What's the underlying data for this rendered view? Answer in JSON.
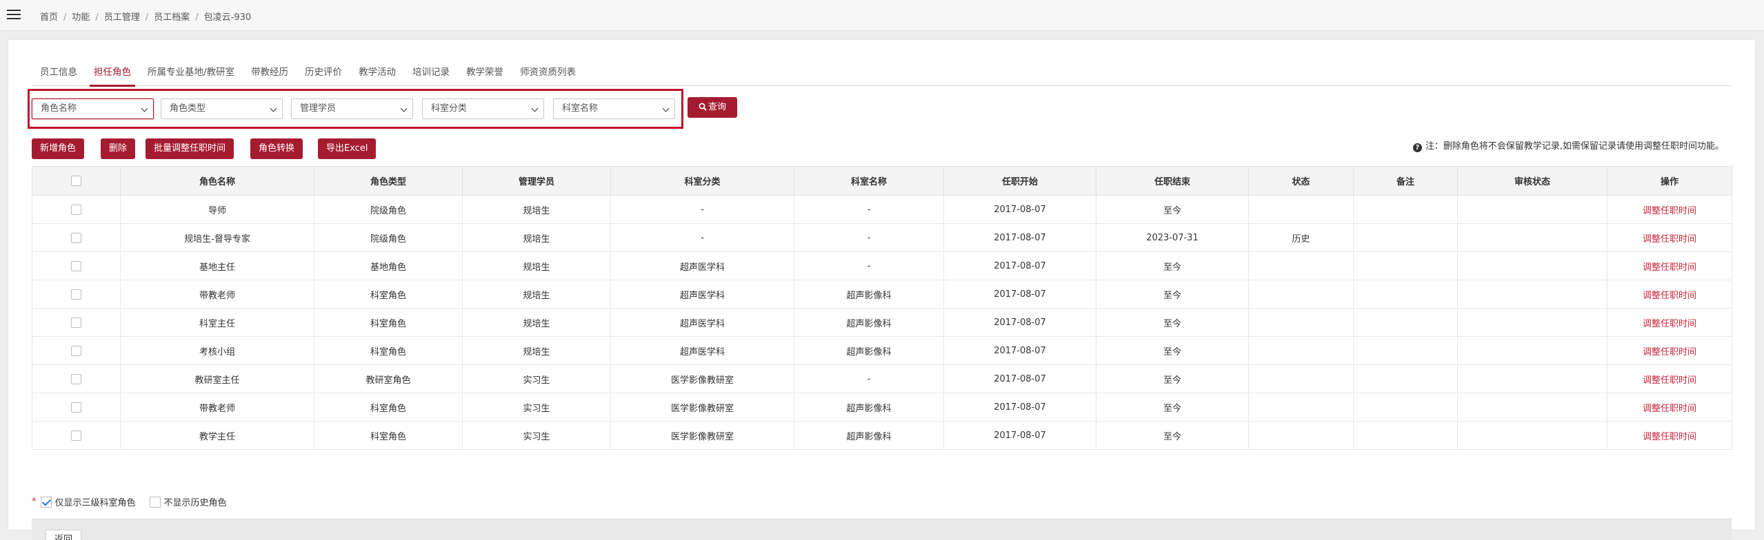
{
  "breadcrumb": [
    "首页",
    "功能",
    "员工管理",
    "员工档案",
    "包凌云-930"
  ],
  "tabs": [
    "员工信息",
    "担任角色",
    "所属专业基地/教研室",
    "带教经历",
    "历史评价",
    "教学活动",
    "培训记录",
    "教学荣誉",
    "师资资质列表"
  ],
  "active_tab": "担任角色",
  "filters": {
    "role_name": "角色名称",
    "role_type": "角色类型",
    "managed_students": "管理学员",
    "dept_category": "科室分类",
    "dept_name": "科室名称",
    "query_label": "查询"
  },
  "toolbar": {
    "add_role": "新增角色",
    "delete": "删除",
    "batch_adjust": "批量调整任职时间",
    "role_convert": "角色转换",
    "export_excel": "导出Excel"
  },
  "notice": "注：删除角色将不会保留教学记录,如需保留记录请使用调整任职时间功能。",
  "table": {
    "headers": [
      "角色名称",
      "角色类型",
      "管理学员",
      "科室分类",
      "科室名称",
      "任职开始",
      "任职结束",
      "状态",
      "备注",
      "审核状态",
      "操作"
    ],
    "rows": [
      [
        "导师",
        "院级角色",
        "规培生",
        "-",
        "-",
        "2017-08-07",
        "至今",
        "",
        "",
        "",
        "调整任职时间"
      ],
      [
        "规培生-督导专家",
        "院级角色",
        "规培生",
        "-",
        "-",
        "2017-08-07",
        "2023-07-31",
        "历史",
        "",
        "",
        "调整任职时间"
      ],
      [
        "基地主任",
        "基地角色",
        "规培生",
        "超声医学科",
        "-",
        "2017-08-07",
        "至今",
        "",
        "",
        "",
        "调整任职时间"
      ],
      [
        "带教老师",
        "科室角色",
        "规培生",
        "超声医学科",
        "超声影像科",
        "2017-08-07",
        "至今",
        "",
        "",
        "",
        "调整任职时间"
      ],
      [
        "科室主任",
        "科室角色",
        "规培生",
        "超声医学科",
        "超声影像科",
        "2017-08-07",
        "至今",
        "",
        "",
        "",
        "调整任职时间"
      ],
      [
        "考核小组",
        "科室角色",
        "规培生",
        "超声医学科",
        "超声影像科",
        "2017-08-07",
        "至今",
        "",
        "",
        "",
        "调整任职时间"
      ],
      [
        "教研室主任",
        "教研室角色",
        "实习生",
        "医学影像教研室",
        "-",
        "2017-08-07",
        "至今",
        "",
        "",
        "",
        "调整任职时间"
      ],
      [
        "带教老师",
        "科室角色",
        "实习生",
        "医学影像教研室",
        "超声影像科",
        "2017-08-07",
        "至今",
        "",
        "",
        "",
        "调整任职时间"
      ],
      [
        "教学主任",
        "科室角色",
        "实习生",
        "医学影像教研室",
        "超声影像科",
        "2017-08-07",
        "至今",
        "",
        "",
        "",
        "调整任职时间"
      ]
    ]
  },
  "options": {
    "required_mark": "*",
    "show_level3_label": "仅显示三级科室角色",
    "show_level3_checked": true,
    "hide_history_label": "不显示历史角色",
    "hide_history_checked": false
  },
  "footer": {
    "back_label": "返回"
  },
  "colors": {
    "accent": "#a51c30",
    "highlight_border": "#c0102a",
    "link": "#c9253b"
  }
}
